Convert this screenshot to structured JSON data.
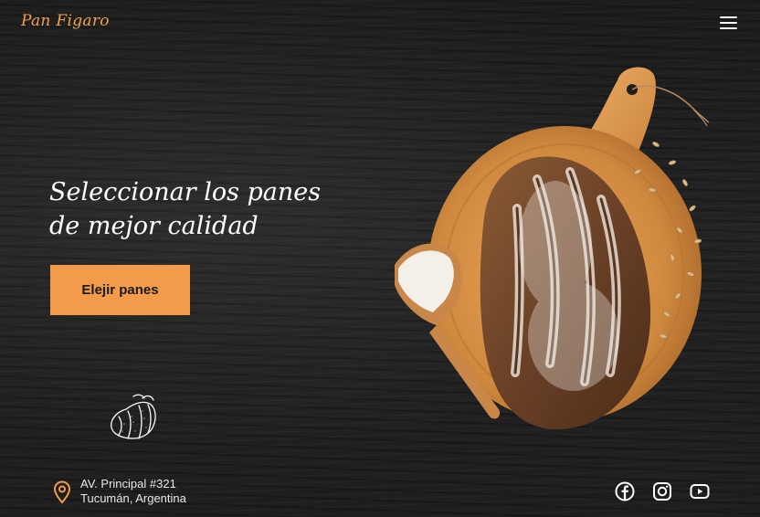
{
  "header": {
    "brand": "Pan Figaro",
    "menu_icon": "hamburger-menu-icon"
  },
  "hero": {
    "headline_line1": "Seleccionar los panes",
    "headline_line2": "de mejor calidad",
    "cta_label": "Elejir panes",
    "image": "bread-on-cutting-board",
    "decoration_icon": "croissant-icon"
  },
  "footer": {
    "address_icon": "location-pin-icon",
    "address_line1": "AV. Principal #321",
    "address_line2": "Tucumán, Argentina",
    "social": [
      "facebook-icon",
      "instagram-icon",
      "youtube-icon"
    ]
  },
  "colors": {
    "accent": "#f29b4b",
    "brand": "#f0a24c",
    "background": "#1e1e1e",
    "text": "#ffffff"
  }
}
